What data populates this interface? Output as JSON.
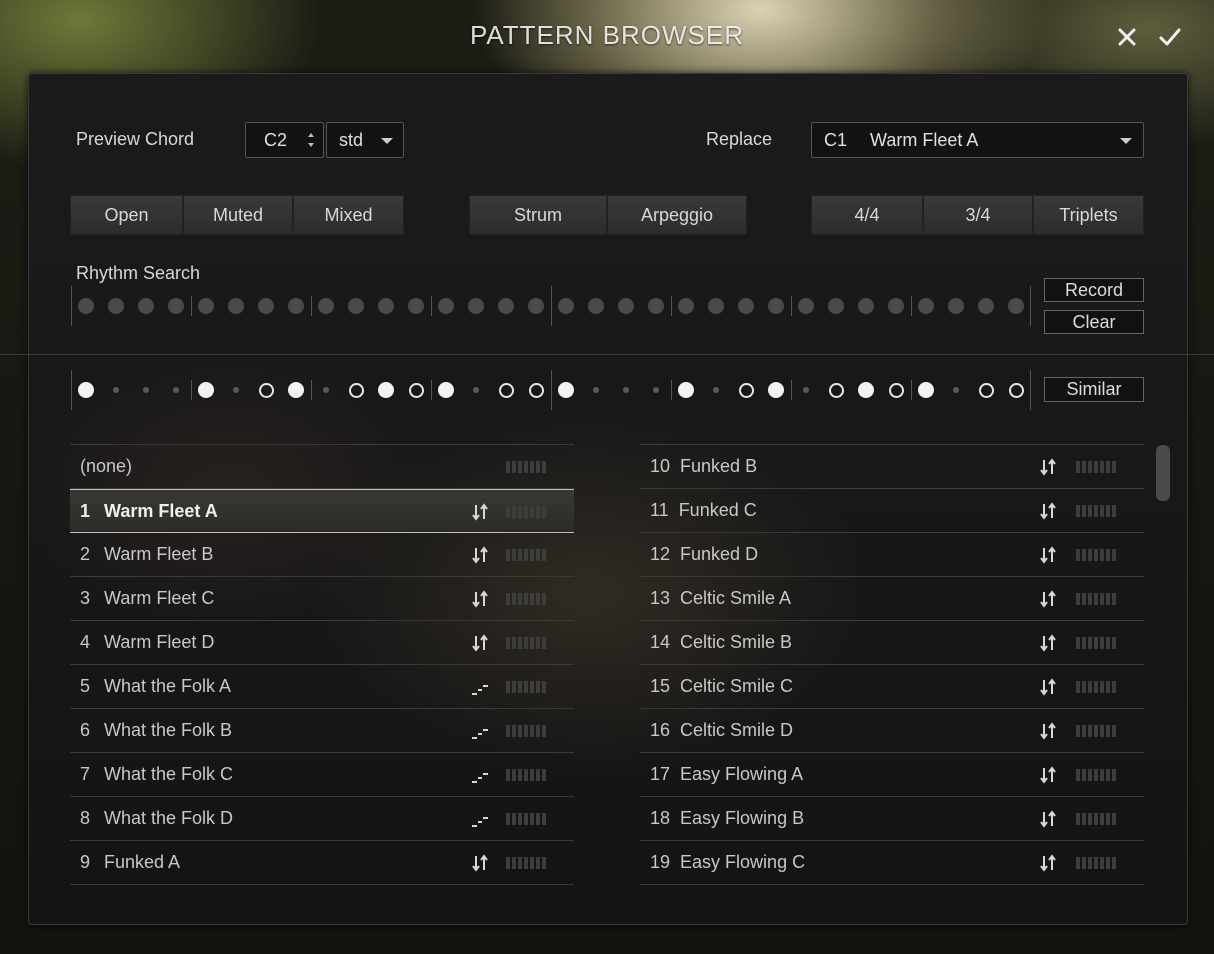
{
  "window": {
    "title": "PATTERN BROWSER"
  },
  "preview": {
    "label": "Preview Chord",
    "note": "C2",
    "voicing": "std"
  },
  "replace": {
    "label": "Replace",
    "slot": "C1",
    "pattern": "Warm Fleet A"
  },
  "filters": {
    "mode": [
      "Open",
      "Muted",
      "Mixed"
    ],
    "style": [
      "Strum",
      "Arpeggio"
    ],
    "meter": [
      "4/4",
      "3/4",
      "Triplets"
    ]
  },
  "rhythm_search": {
    "label": "Rhythm Search",
    "record_label": "Record",
    "clear_label": "Clear",
    "steps": 32
  },
  "current_rhythm": {
    "similar_label": "Similar",
    "steps": [
      "F",
      "s",
      "s",
      "s",
      "F",
      "s",
      "O",
      "F",
      "s",
      "O",
      "F",
      "O",
      "F",
      "s",
      "O",
      "O",
      "F",
      "s",
      "s",
      "s",
      "F",
      "s",
      "O",
      "F",
      "s",
      "O",
      "F",
      "O",
      "F",
      "s",
      "O",
      "O"
    ]
  },
  "patterns_left": [
    {
      "num": "",
      "name": "(none)",
      "icon": "none"
    },
    {
      "num": "1",
      "name": "Warm Fleet A",
      "icon": "updown"
    },
    {
      "num": "2",
      "name": "Warm Fleet B",
      "icon": "updown"
    },
    {
      "num": "3",
      "name": "Warm Fleet C",
      "icon": "updown"
    },
    {
      "num": "4",
      "name": "Warm Fleet D",
      "icon": "updown"
    },
    {
      "num": "5",
      "name": "What the Folk A",
      "icon": "arp"
    },
    {
      "num": "6",
      "name": "What the Folk B",
      "icon": "arp"
    },
    {
      "num": "7",
      "name": "What the Folk C",
      "icon": "arp"
    },
    {
      "num": "8",
      "name": "What the Folk D",
      "icon": "arp"
    },
    {
      "num": "9",
      "name": "Funked A",
      "icon": "updown"
    }
  ],
  "patterns_right": [
    {
      "num": "10",
      "name": "Funked B",
      "icon": "updown"
    },
    {
      "num": "11",
      "name": "Funked C",
      "icon": "updown"
    },
    {
      "num": "12",
      "name": "Funked D",
      "icon": "updown"
    },
    {
      "num": "13",
      "name": "Celtic Smile A",
      "icon": "updown"
    },
    {
      "num": "14",
      "name": "Celtic Smile B",
      "icon": "updown"
    },
    {
      "num": "15",
      "name": "Celtic Smile C",
      "icon": "updown"
    },
    {
      "num": "16",
      "name": "Celtic Smile D",
      "icon": "updown"
    },
    {
      "num": "17",
      "name": "Easy Flowing A",
      "icon": "updown"
    },
    {
      "num": "18",
      "name": "Easy Flowing B",
      "icon": "updown"
    },
    {
      "num": "19",
      "name": "Easy Flowing C",
      "icon": "updown"
    }
  ],
  "selected_pattern": "1"
}
